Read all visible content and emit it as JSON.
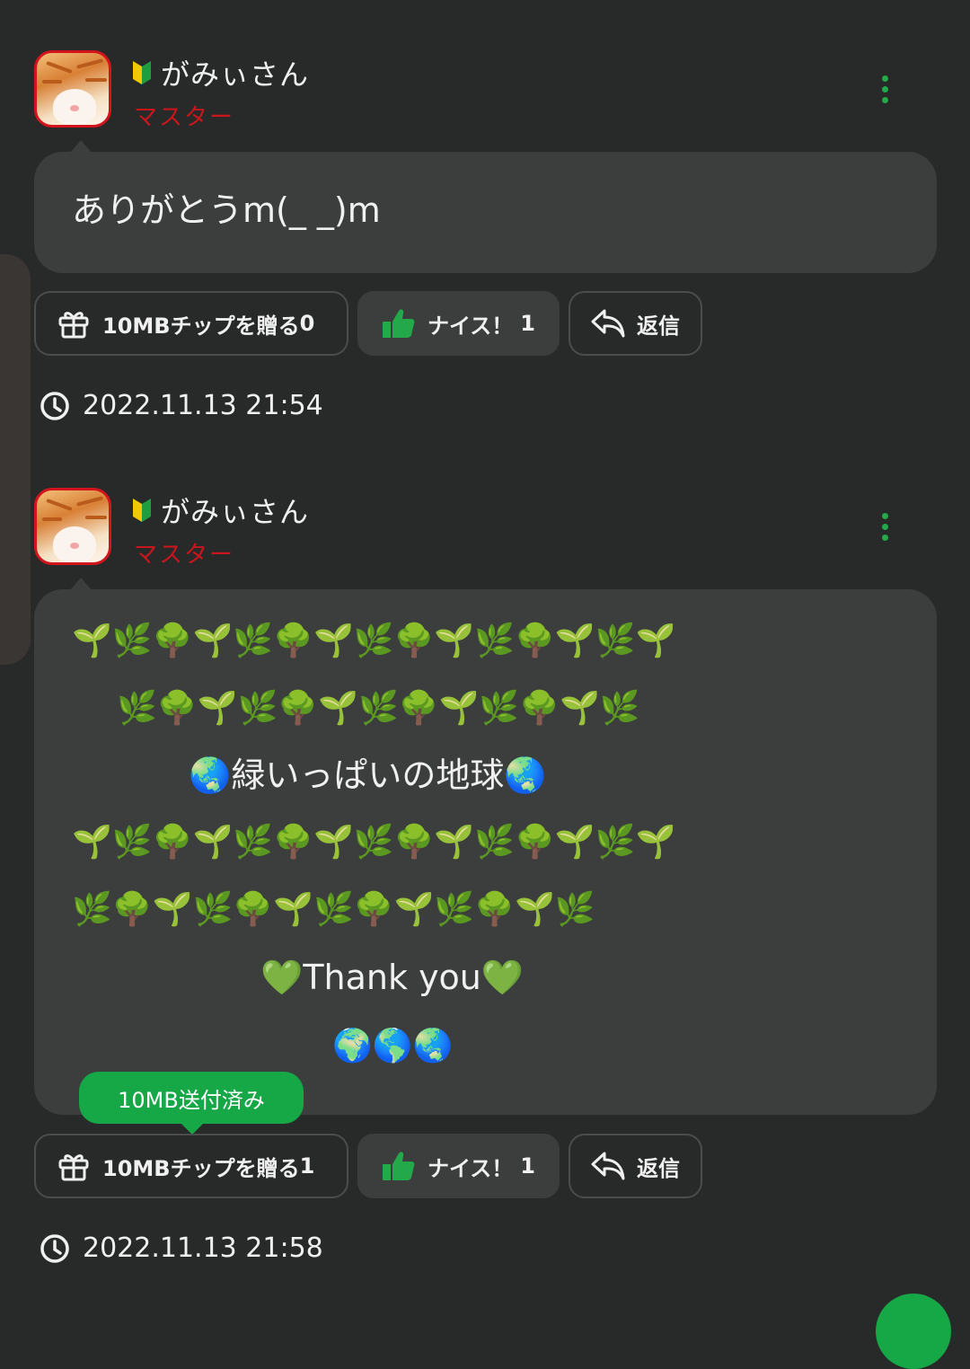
{
  "posts": [
    {
      "username": "がみぃさん",
      "role": "マスター",
      "message": "ありがとうm(_ _)m",
      "tip_label": "10MBチップを贈る",
      "tip_count": "0",
      "nice_label": "ナイス！",
      "nice_count": "1",
      "reply_label": "返信",
      "timestamp": "2022.11.13 21:54"
    },
    {
      "username": "がみぃさん",
      "role": "マスター",
      "message_lines": [
        "🌱🌿🌳🌱🌿🌳🌱🌿🌳🌱🌿🌳🌱🌿🌱",
        "🌿🌳🌱🌿🌳🌱🌿🌳🌱🌿🌳🌱🌿",
        "🌏緑いっぱいの地球🌏",
        "🌱🌿🌳🌱🌿🌳🌱🌿🌳🌱🌿🌳🌱🌿🌱",
        "🌿🌳🌱🌿🌳🌱🌿🌳🌱🌿🌳🌱🌿",
        "💚Thank you💚",
        "🌍🌎🌏"
      ],
      "sent_badge": "10MB送付済み",
      "tip_label": "10MBチップを贈る",
      "tip_count": "1",
      "nice_label": "ナイス！",
      "nice_count": "1",
      "reply_label": "返信",
      "timestamp": "2022.11.13 21:58"
    }
  ],
  "icons": {
    "beginner": "beginner-mark-icon",
    "menu": "more-vertical-icon",
    "gift": "gift-icon",
    "thumbs_up": "thumbs-up-icon",
    "reply": "reply-icon",
    "clock": "clock-icon"
  },
  "colors": {
    "background": "#282a2a",
    "bubble": "#3b3e3c",
    "accent_green": "#16a746",
    "role_red": "#c8161c"
  }
}
